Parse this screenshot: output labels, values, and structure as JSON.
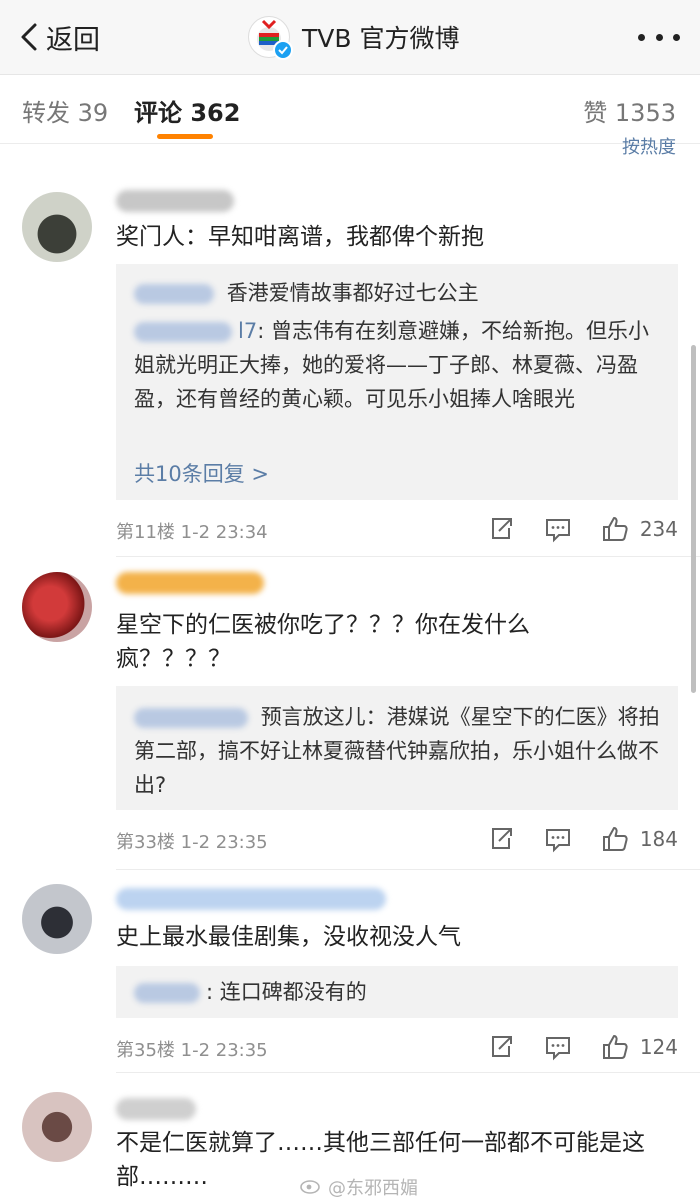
{
  "header": {
    "back_label": "返回",
    "title": "TVB 官方微博",
    "logo_icon": "tvb-logo-icon",
    "verified_icon": "verified-badge-icon"
  },
  "tabs": {
    "repost": "转发 39",
    "comments": "评论 362",
    "likes": "赞 1353",
    "sort": "按热度"
  },
  "accent_color": "#ff8200",
  "link_color": "#5b7da6",
  "comments": [
    {
      "text": "奖门人：早知咁离谱，我都俾个新抱",
      "replies": [
        {
          "tail": "",
          "text": "香港爱情故事都好过七公主"
        },
        {
          "tail": "l7",
          "text": ": 曾志伟有在刻意避嫌，不给新抱。但乐小姐就光明正大捧，她的爱将——丁子郎、林夏薇、冯盈盈，还有曾经的黄心颖。可见乐小姐捧人啥眼光"
        }
      ],
      "more_replies": "共10条回复 >",
      "meta": "第11楼 1-2 23:34",
      "likes": "234"
    },
    {
      "text": "星空下的仁医被你吃了？？？你在发什么疯？？？？",
      "replies": [
        {
          "tail": "",
          "text": "预言放这儿：港媒说《星空下的仁医》将拍第二部，搞不好让林夏薇替代钟嘉欣拍，乐小姐什么做不出?"
        }
      ],
      "meta": "第33楼 1-2 23:35",
      "likes": "184"
    },
    {
      "text": "史上最水最佳剧集，没收视没人气",
      "replies": [
        {
          "tail": "",
          "text": ": 连口碑都没有的"
        }
      ],
      "meta": "第35楼 1-2 23:35",
      "likes": "124"
    },
    {
      "text": "不是仁医就算了……其他三部任何一部都不可能是这部………"
    }
  ],
  "watermark": "@东邪西媚"
}
